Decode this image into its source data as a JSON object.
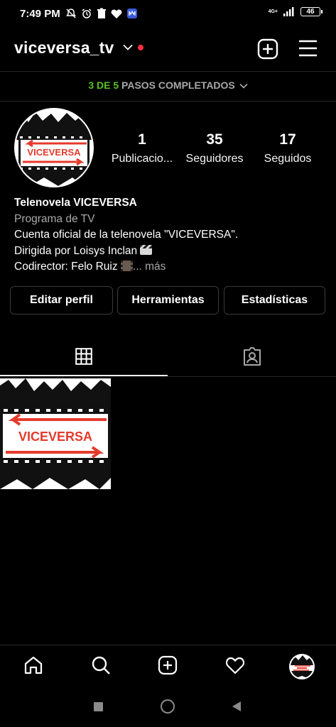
{
  "status_bar": {
    "time": "7:49 PM",
    "network": "4G+",
    "battery": "46"
  },
  "header": {
    "username": "viceversa_tv"
  },
  "setup": {
    "done": "3 DE 5",
    "text": "PASOS COMPLETADOS"
  },
  "avatar": {
    "logo_text": "VICEVERSA"
  },
  "stats": [
    {
      "value": "1",
      "label": "Publicacio..."
    },
    {
      "value": "35",
      "label": "Seguidores"
    },
    {
      "value": "17",
      "label": "Seguidos"
    }
  ],
  "bio": {
    "name": "Telenovela VICEVERSA",
    "category": "Programa de TV",
    "line1": "Cuenta oficial de la telenovela \"VICEVERSA\".",
    "line2": "Dirigida por Loisys Inclan",
    "line3": "Codirector: Felo Ruiz",
    "ellipsis": "...",
    "more": "más"
  },
  "buttons": {
    "edit": "Editar perfil",
    "tools": "Herramientas",
    "stats": "Estadísticas"
  },
  "tabs": [
    {
      "icon": "grid-icon",
      "active": true
    },
    {
      "icon": "tagged-icon",
      "active": false
    }
  ],
  "posts": [
    {
      "logo_text": "VICEVERSA"
    }
  ],
  "bottom_nav": [
    "home-icon",
    "search-icon",
    "create-icon",
    "heart-icon",
    "profile-avatar"
  ],
  "colors": {
    "background": "#000000",
    "accent_green": "#58c322",
    "notification_red": "#ff3040",
    "logo_red": "#e53a2c"
  }
}
